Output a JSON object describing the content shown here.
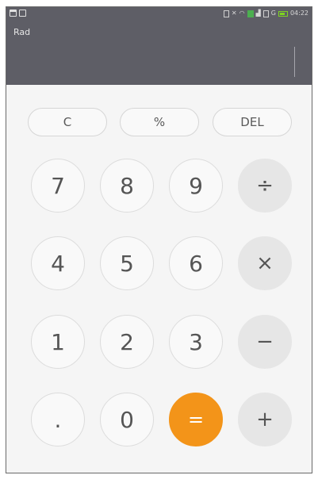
{
  "status_bar": {
    "time": "04:22",
    "network": "G"
  },
  "display": {
    "mode": "Rad",
    "expression": ""
  },
  "function_keys": {
    "clear": "C",
    "percent": "%",
    "delete": "DEL"
  },
  "keys": {
    "seven": "7",
    "eight": "8",
    "nine": "9",
    "divide": "÷",
    "four": "4",
    "five": "5",
    "six": "6",
    "multiply": "×",
    "one": "1",
    "two": "2",
    "three": "3",
    "minus": "−",
    "decimal": ".",
    "zero": "0",
    "equals": "=",
    "plus": "+"
  },
  "colors": {
    "display_bg": "#5e5e66",
    "keypad_bg": "#f5f5f5",
    "equals_accent": "#f39419"
  }
}
